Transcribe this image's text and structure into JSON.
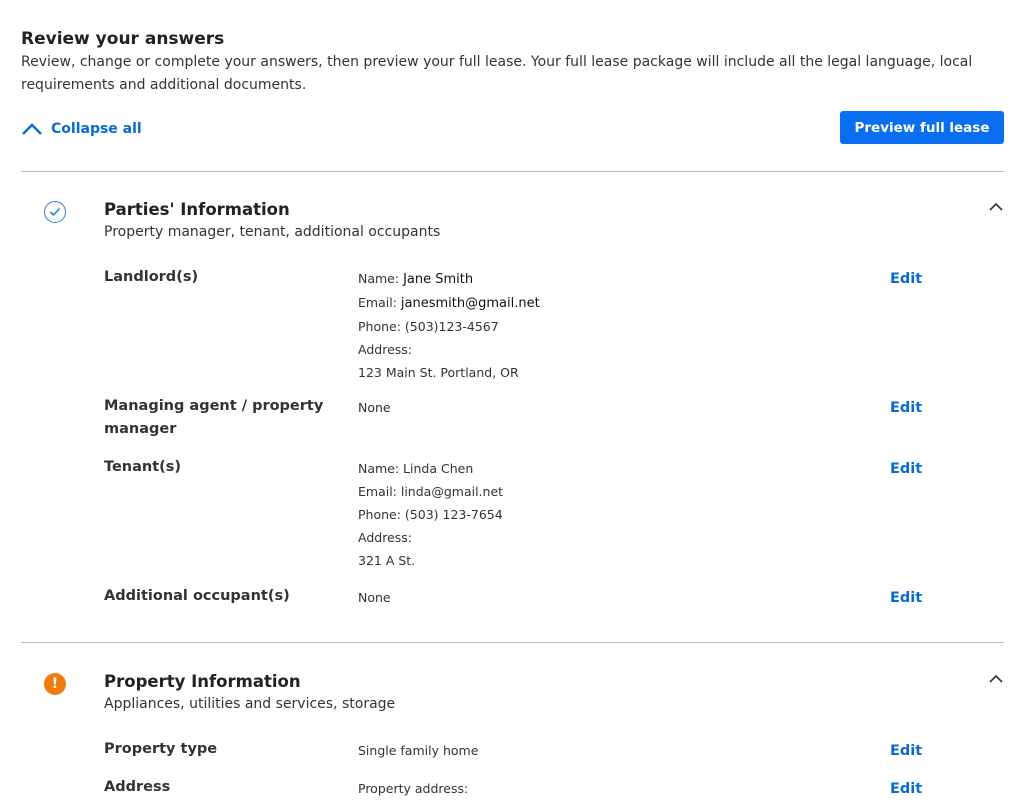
{
  "header": {
    "title": "Review your answers",
    "intro": "Review, change or complete your answers, then preview your full lease. Your full lease package will include all the legal language, local requirements and additional documents."
  },
  "toolbar": {
    "collapse_label": "Collapse all",
    "preview_label": "Preview full lease"
  },
  "sections": [
    {
      "title": "Parties' Information",
      "subtitle": "Property manager, tenant, additional occupants",
      "status": "complete",
      "rows": [
        {
          "label": "Landlord(s)",
          "lines": [
            "Name:",
            "Jane Smith",
            "Email:",
            "janesmith@gmail.net",
            "Phone: (503)123-4567",
            "Address:",
            "123 Main St. Portland, OR"
          ],
          "edit": "Edit"
        },
        {
          "label": "Managing agent / property manager",
          "lines": [
            "None"
          ],
          "edit": "Edit"
        },
        {
          "label": "Tenant(s)",
          "lines": [
            "Name: Linda Chen",
            "Email: linda@gmail.net",
            "Phone: (503) 123-7654",
            "Address:",
            "321 A St."
          ],
          "edit": "Edit"
        },
        {
          "label": "Additional occupant(s)",
          "lines": [
            "None"
          ],
          "edit": "Edit"
        }
      ]
    },
    {
      "title": "Property Information",
      "subtitle": "Appliances, utilities and services, storage",
      "status": "warning",
      "status_glyph": "!",
      "rows": [
        {
          "label": "Property type",
          "lines": [
            "Single family home"
          ],
          "edit": "Edit"
        },
        {
          "label": "Address",
          "lines": [
            "Property address:"
          ],
          "edit": "Edit"
        }
      ]
    }
  ],
  "colors": {
    "accent": "#0a6ef0",
    "link": "#0a6ad4",
    "warning": "#f07d0b"
  }
}
